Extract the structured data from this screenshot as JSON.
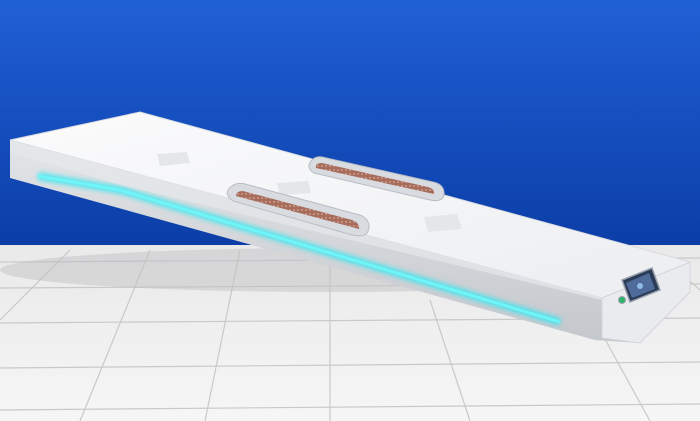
{
  "scene": {
    "subject": "therapy-bed",
    "colors": {
      "sky_top": "#1d5ed0",
      "sky_bottom": "#0e3fa8",
      "floor_light": "#f3f3f3",
      "floor_dark": "#cfcfcf",
      "bed_white": "#f4f4f5",
      "bed_shadow": "#c9cbd0",
      "led_strip": "#36e2ec",
      "heat_pad": "#b27a6a"
    }
  }
}
